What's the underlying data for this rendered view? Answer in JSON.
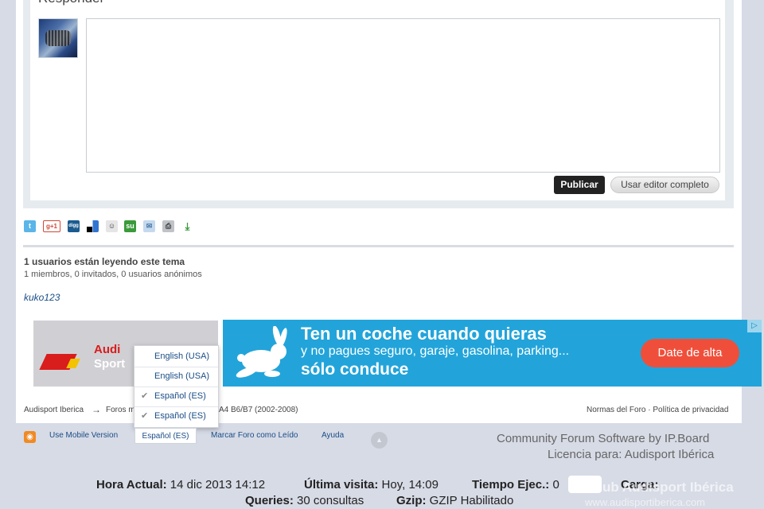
{
  "reply": {
    "title": "Responder",
    "publish_label": "Publicar",
    "full_editor_label": "Usar editor completo"
  },
  "share_icons": [
    "twitter-icon",
    "google-plus-icon",
    "digg-icon",
    "delicious-icon",
    "reddit-icon",
    "stumbleupon-icon",
    "email-icon",
    "print-icon",
    "download-icon"
  ],
  "readers": {
    "title": "1 usuarios están leyendo este tema",
    "subtitle": "1 miembros, 0 invitados, 0 usuarios anónimos",
    "users": [
      "kuko123"
    ]
  },
  "ads": {
    "left_brand_line1": "Audi",
    "left_brand_line2": "Sport",
    "right_headline": "Ten un coche cuando quieras",
    "right_subline": "y no pagues seguro, garaje, gasolina, parking...",
    "right_tagline": "sólo conduce",
    "right_cta": "Date de alta",
    "ad_choice": "▷"
  },
  "language_menu": {
    "items": [
      {
        "label": "English (USA)",
        "checked": false
      },
      {
        "label": "English (USA)",
        "checked": false
      },
      {
        "label": "Español (ES)",
        "checked": true
      },
      {
        "label": "Español (ES)",
        "checked": true
      }
    ]
  },
  "breadcrumb": {
    "root": "Audisport Iberica",
    "arrow": "→",
    "forum": "Foros m",
    "tail": "A4 B6/B7 (2002-2008)"
  },
  "footer_links": {
    "rules": "Normas del Foro · Política de privacidad",
    "mobile": "Use Mobile Version",
    "language": "Español (ES)",
    "mark_read": "Marcar Foro como Leído",
    "help": "Ayuda",
    "powered": "Community Forum Software by IP.Board",
    "licence": "Licencia para: Audisport Ibérica"
  },
  "stats": {
    "current_time_label": "Hora Actual:",
    "current_time_value": "14 dic 2013 14:12",
    "last_visit_label": "Última visita:",
    "last_visit_value": "Hoy, 14:09",
    "exec_time_label": "Tiempo Ejec.:",
    "exec_time_value": "0",
    "load_label": "Carga:",
    "queries_label": "Queries:",
    "queries_value": "30 consultas",
    "gzip_label": "Gzip:",
    "gzip_value": "GZIP Habilitado"
  },
  "watermark": {
    "line1": "Club Audisport Ibérica",
    "line2": "www.audisportiberica.com"
  },
  "colors": {
    "page_bg": "#d7dbe6",
    "link": "#1a4d86",
    "ad_blue": "#22a4da",
    "cta_red": "#ef4f3a"
  }
}
